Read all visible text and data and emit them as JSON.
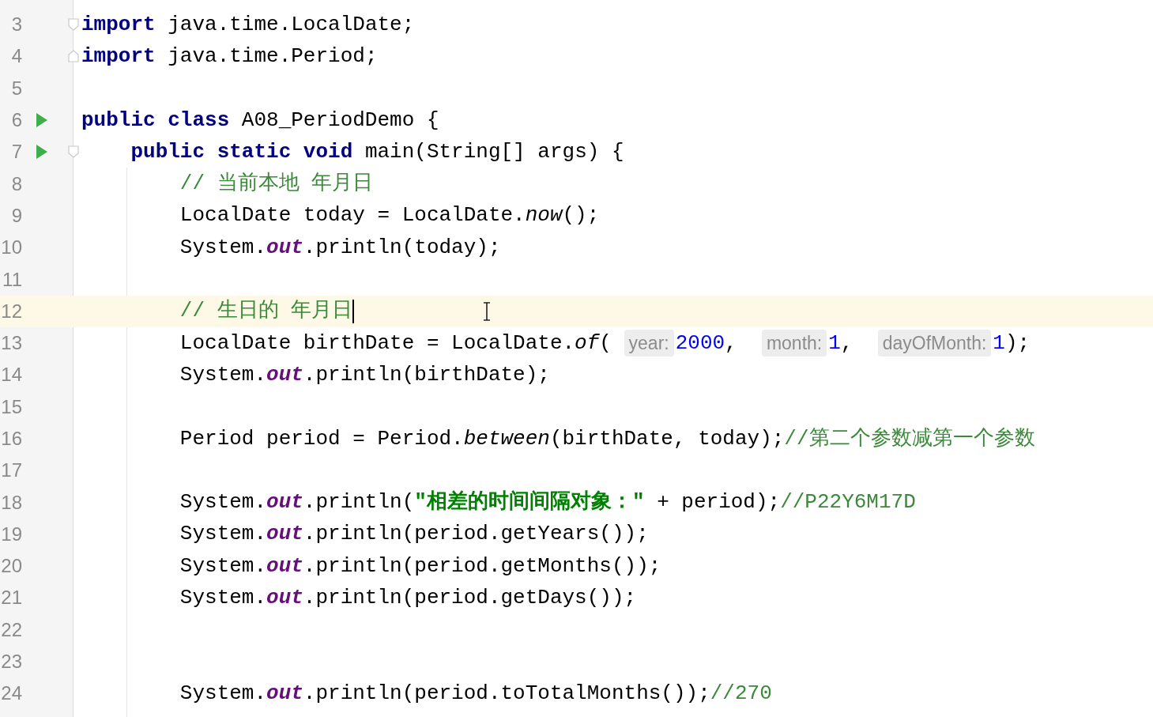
{
  "editor": {
    "lines": [
      {
        "number": "3",
        "run": false,
        "fold_open": true,
        "fold_close": false,
        "current": false,
        "tokens": [
          {
            "kind": "keyword",
            "text": "import"
          },
          {
            "kind": "plain",
            "text": " java.time.LocalDate;"
          }
        ]
      },
      {
        "number": "4",
        "run": false,
        "fold_open": false,
        "fold_close": true,
        "current": false,
        "tokens": [
          {
            "kind": "keyword",
            "text": "import"
          },
          {
            "kind": "plain",
            "text": " java.time.Period;"
          }
        ]
      },
      {
        "number": "5",
        "run": false,
        "fold_open": false,
        "fold_close": false,
        "current": false
      },
      {
        "number": "6",
        "run": true,
        "fold_open": false,
        "fold_close": false,
        "current": false,
        "tokens": [
          {
            "kind": "keyword",
            "text": "public class"
          },
          {
            "kind": "plain",
            "text": " A08_PeriodDemo {"
          }
        ]
      },
      {
        "number": "7",
        "run": true,
        "fold_open": true,
        "fold_close": false,
        "current": false,
        "tokens": [
          {
            "kind": "keyword",
            "text": "    public static void"
          },
          {
            "kind": "plain",
            "text": " main(String[] args) {"
          }
        ]
      },
      {
        "number": "8",
        "run": false,
        "fold_open": false,
        "fold_close": false,
        "current": false,
        "tokens": [
          {
            "kind": "comment",
            "text": "        // 当前本地 年月日"
          }
        ]
      },
      {
        "number": "9",
        "run": false,
        "fold_open": false,
        "fold_close": false,
        "current": false,
        "tokens": [
          {
            "kind": "plain",
            "text": "        LocalDate today = LocalDate."
          },
          {
            "kind": "static-method",
            "text": "now"
          },
          {
            "kind": "plain",
            "text": "();"
          }
        ]
      },
      {
        "number": "10",
        "run": false,
        "fold_open": false,
        "fold_close": false,
        "current": false,
        "tokens": [
          {
            "kind": "plain",
            "text": "        System."
          },
          {
            "kind": "static-field",
            "text": "out"
          },
          {
            "kind": "plain",
            "text": ".println(today);"
          }
        ]
      },
      {
        "number": "11",
        "run": false,
        "fold_open": false,
        "fold_close": false,
        "current": false
      },
      {
        "number": "12",
        "run": false,
        "fold_open": false,
        "fold_close": false,
        "current": true,
        "tokens": [
          {
            "kind": "comment",
            "text": "        // 生日的 年月日"
          }
        ]
      },
      {
        "number": "13",
        "run": false,
        "fold_open": false,
        "fold_close": false,
        "current": false,
        "tokens": [
          {
            "kind": "plain",
            "text": "        LocalDate birthDate = LocalDate."
          },
          {
            "kind": "static-method",
            "text": "of"
          },
          {
            "kind": "plain",
            "text": "( "
          },
          {
            "kind": "hint",
            "text": "year:"
          },
          {
            "kind": "number",
            "text": "2000"
          },
          {
            "kind": "plain",
            "text": ",  "
          },
          {
            "kind": "hint",
            "text": "month:"
          },
          {
            "kind": "number",
            "text": "1"
          },
          {
            "kind": "plain",
            "text": ",  "
          },
          {
            "kind": "hint",
            "text": "dayOfMonth:"
          },
          {
            "kind": "number",
            "text": "1"
          },
          {
            "kind": "plain",
            "text": ");"
          }
        ]
      },
      {
        "number": "14",
        "run": false,
        "fold_open": false,
        "fold_close": false,
        "current": false,
        "tokens": [
          {
            "kind": "plain",
            "text": "        System."
          },
          {
            "kind": "static-field",
            "text": "out"
          },
          {
            "kind": "plain",
            "text": ".println(birthDate);"
          }
        ]
      },
      {
        "number": "15",
        "run": false,
        "fold_open": false,
        "fold_close": false,
        "current": false
      },
      {
        "number": "16",
        "run": false,
        "fold_open": false,
        "fold_close": false,
        "current": false,
        "tokens": [
          {
            "kind": "plain",
            "text": "        Period period = Period."
          },
          {
            "kind": "static-method",
            "text": "between"
          },
          {
            "kind": "plain",
            "text": "(birthDate, today);"
          },
          {
            "kind": "comment",
            "text": "//第二个参数减第一个参数"
          }
        ]
      },
      {
        "number": "17",
        "run": false,
        "fold_open": false,
        "fold_close": false,
        "current": false
      },
      {
        "number": "18",
        "run": false,
        "fold_open": false,
        "fold_close": false,
        "current": false,
        "tokens": [
          {
            "kind": "plain",
            "text": "        System."
          },
          {
            "kind": "static-field",
            "text": "out"
          },
          {
            "kind": "plain",
            "text": ".println("
          },
          {
            "kind": "string",
            "text": "\"相差的时间间隔对象：\""
          },
          {
            "kind": "plain",
            "text": " + period);"
          },
          {
            "kind": "comment",
            "text": "//P22Y6M17D"
          }
        ]
      },
      {
        "number": "19",
        "run": false,
        "fold_open": false,
        "fold_close": false,
        "current": false,
        "tokens": [
          {
            "kind": "plain",
            "text": "        System."
          },
          {
            "kind": "static-field",
            "text": "out"
          },
          {
            "kind": "plain",
            "text": ".println(period.getYears());"
          }
        ]
      },
      {
        "number": "20",
        "run": false,
        "fold_open": false,
        "fold_close": false,
        "current": false,
        "tokens": [
          {
            "kind": "plain",
            "text": "        System."
          },
          {
            "kind": "static-field",
            "text": "out"
          },
          {
            "kind": "plain",
            "text": ".println(period.getMonths());"
          }
        ]
      },
      {
        "number": "21",
        "run": false,
        "fold_open": false,
        "fold_close": false,
        "current": false,
        "tokens": [
          {
            "kind": "plain",
            "text": "        System."
          },
          {
            "kind": "static-field",
            "text": "out"
          },
          {
            "kind": "plain",
            "text": ".println(period.getDays());"
          }
        ]
      },
      {
        "number": "22",
        "run": false,
        "fold_open": false,
        "fold_close": false,
        "current": false
      },
      {
        "number": "23",
        "run": false,
        "fold_open": false,
        "fold_close": false,
        "current": false
      },
      {
        "number": "24",
        "run": false,
        "fold_open": false,
        "fold_close": false,
        "current": false,
        "tokens": [
          {
            "kind": "plain",
            "text": "        System."
          },
          {
            "kind": "static-field",
            "text": "out"
          },
          {
            "kind": "plain",
            "text": ".println(period.toTotalMonths());"
          },
          {
            "kind": "comment",
            "text": "//270"
          }
        ]
      }
    ]
  }
}
